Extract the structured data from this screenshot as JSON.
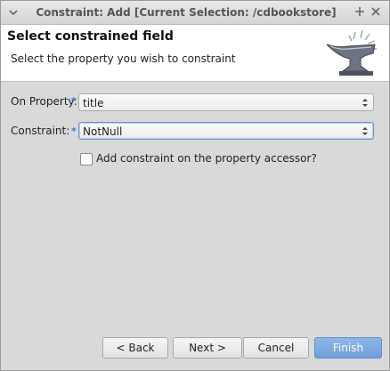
{
  "window": {
    "title": "Constraint: Add [Current Selection: /cdbookstore]",
    "menu_icon": "chevron-down-icon",
    "max_icon": "plus-icon",
    "close_icon": "close-icon"
  },
  "banner": {
    "heading": "Select constrained field",
    "description": "Select the property you wish to constraint",
    "icon": "anvil-icon"
  },
  "form": {
    "property_label": "On Property:",
    "property_value": "title",
    "constraint_label": "Constraint:",
    "constraint_value": "NotNull",
    "required_marker": "*",
    "accessor_checkbox_label": "Add constraint on the property accessor?",
    "accessor_checked": false
  },
  "buttons": {
    "back": "< Back",
    "next": "Next >",
    "cancel": "Cancel",
    "finish": "Finish"
  },
  "colors": {
    "accent": "#6f9fd8",
    "required_marker": "#3a7bd5"
  }
}
